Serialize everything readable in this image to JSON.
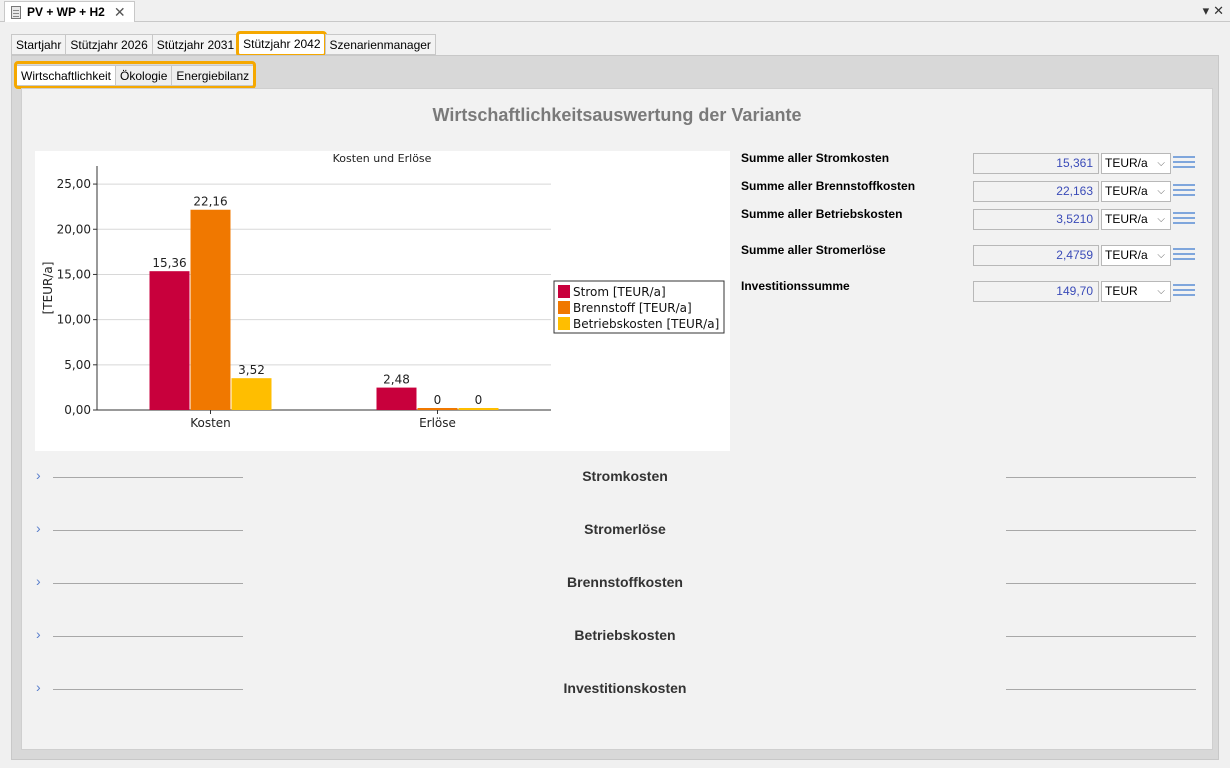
{
  "window": {
    "doc_tab_label": "PV + WP + H2",
    "close_glyph": "✕",
    "controls": [
      "▾",
      "✕"
    ]
  },
  "main_tabs": [
    {
      "label": "Startjahr",
      "active": false
    },
    {
      "label": "Stützjahr 2026",
      "active": false
    },
    {
      "label": "Stützjahr 2031",
      "active": false
    },
    {
      "label": "Stützjahr 2042",
      "active": true
    },
    {
      "label": "Szenarienmanager",
      "active": false
    }
  ],
  "sub_tabs": [
    {
      "label": "Wirtschaftlichkeit",
      "active": true
    },
    {
      "label": "Ökologie",
      "active": false
    },
    {
      "label": "Energiebilanz",
      "active": false
    }
  ],
  "page_title": "Wirtschaftlichkeitsauswertung der Variante",
  "chart_data": {
    "type": "bar",
    "title": "Kosten und Erlöse",
    "ylabel": "[TEUR/a]",
    "xlabel": "",
    "ylim": [
      0,
      27
    ],
    "yticks": [
      "0,00",
      "5,00",
      "10,00",
      "15,00",
      "20,00",
      "25,00"
    ],
    "ytick_values": [
      0,
      5,
      10,
      15,
      20,
      25
    ],
    "categories": [
      "Kosten",
      "Erlöse"
    ],
    "series": [
      {
        "name": "Strom [TEUR/a]",
        "color": "#c8003c",
        "values": [
          15.36,
          2.48
        ],
        "labels": [
          "15,36",
          "2,48"
        ]
      },
      {
        "name": "Brennstoff [TEUR/a]",
        "color": "#f07800",
        "values": [
          22.16,
          0
        ],
        "labels": [
          "22,16",
          "0"
        ]
      },
      {
        "name": "Betriebskosten [TEUR/a]",
        "color": "#ffbe00",
        "values": [
          3.52,
          0
        ],
        "labels": [
          "3,52",
          "0"
        ]
      }
    ],
    "grid": true,
    "legend_position": "right"
  },
  "summary": [
    {
      "label": "Summe aller Stromkosten",
      "value": "15,361",
      "unit": "TEUR/a"
    },
    {
      "label": "Summe aller Brennstoffkosten",
      "value": "22,163",
      "unit": "TEUR/a"
    },
    {
      "label": "Summe aller Betriebskosten",
      "value": "3,5210",
      "unit": "TEUR/a"
    },
    {
      "label": "Summe aller Stromerlöse",
      "value": "2,4759",
      "unit": "TEUR/a"
    },
    {
      "label": "Investitionssumme",
      "value": "149,70",
      "unit": "TEUR"
    }
  ],
  "sections": [
    {
      "title": "Stromkosten"
    },
    {
      "title": "Stromerlöse"
    },
    {
      "title": "Brennstoffkosten"
    },
    {
      "title": "Betriebskosten"
    },
    {
      "title": "Investitionskosten"
    }
  ],
  "icons": {
    "section_chevron": "›",
    "dropdown_chevron": "⌵"
  }
}
